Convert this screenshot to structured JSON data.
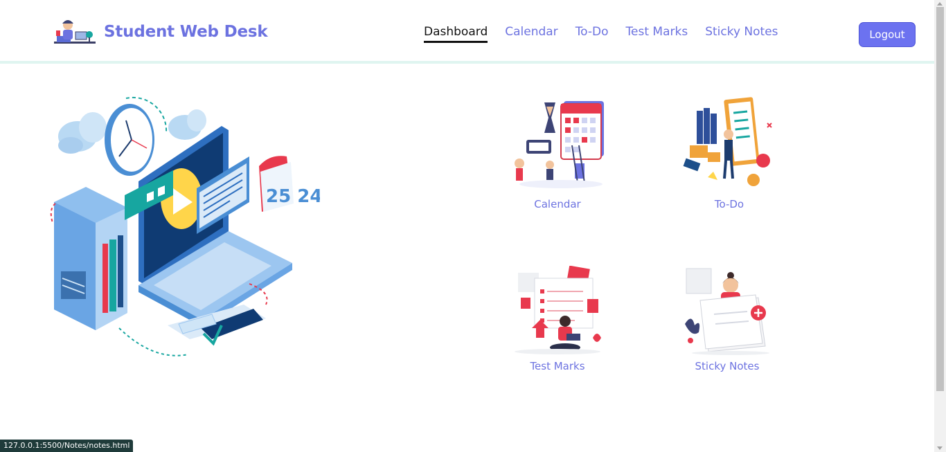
{
  "brand": {
    "title": "Student Web Desk",
    "logo_icon": "student-desk-logo-icon"
  },
  "nav": {
    "items": [
      {
        "label": "Dashboard",
        "active": true
      },
      {
        "label": "Calendar",
        "active": false
      },
      {
        "label": "To-Do",
        "active": false
      },
      {
        "label": "Test Marks",
        "active": false
      },
      {
        "label": "Sticky Notes",
        "active": false
      }
    ],
    "logout_label": "Logout"
  },
  "hero": {
    "illustration": "isometric-workspace-illustration",
    "calendar_digits": "25 24"
  },
  "cards": [
    {
      "label": "Calendar",
      "icon": "calendar-illustration-icon"
    },
    {
      "label": "To-Do",
      "icon": "todo-illustration-icon"
    },
    {
      "label": "Test Marks",
      "icon": "test-marks-illustration-icon"
    },
    {
      "label": "Sticky Notes",
      "icon": "sticky-notes-illustration-icon"
    }
  ],
  "status_bar": {
    "url": "127.0.0.1:5500/Notes/notes.html"
  },
  "colors": {
    "accent": "#6c72e0",
    "button": "#6c72f0",
    "divider": "#dff5f0",
    "teal": "#17a6a0",
    "red": "#e8394d"
  }
}
